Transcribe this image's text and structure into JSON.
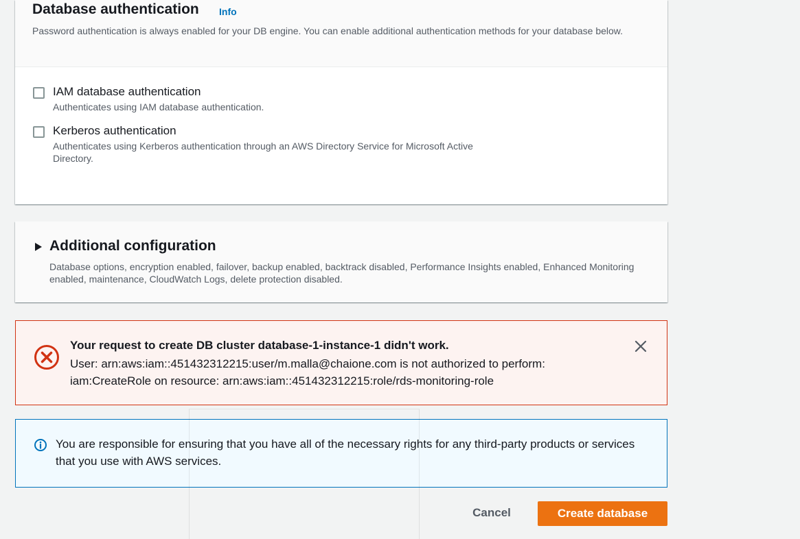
{
  "auth": {
    "title": "Database authentication",
    "info_link": "Info",
    "description": "Password authentication is always enabled for your DB engine. You can enable additional authentication methods for your database below.",
    "options": [
      {
        "label": "IAM database authentication",
        "description": "Authenticates using IAM database authentication.",
        "checked": false
      },
      {
        "label": "Kerberos authentication",
        "description": "Authenticates using Kerberos authentication through an AWS Directory Service for Microsoft Active Directory.",
        "checked": false
      }
    ]
  },
  "additional_config": {
    "title": "Additional configuration",
    "description": "Database options, encryption enabled, failover, backup enabled, backtrack disabled, Performance Insights enabled, Enhanced Monitoring enabled, maintenance, CloudWatch Logs, delete protection disabled.",
    "expanded": false
  },
  "error_alert": {
    "title": "Your request to create DB cluster database-1-instance-1 didn't work.",
    "message": "User: arn:aws:iam::451432312215:user/m.malla@chaione.com is not authorized to perform: iam:CreateRole on resource: arn:aws:iam::451432312215:role/rds-monitoring-role",
    "icon": "error-x-circle-icon",
    "color": "#d13212"
  },
  "info_alert": {
    "message": "You are responsible for ensuring that you have all of the necessary rights for any third-party products or services that you use with AWS services.",
    "icon": "info-circle-icon",
    "color": "#0073bb"
  },
  "footer": {
    "cancel_label": "Cancel",
    "create_label": "Create database",
    "primary_color": "#ec7211"
  }
}
